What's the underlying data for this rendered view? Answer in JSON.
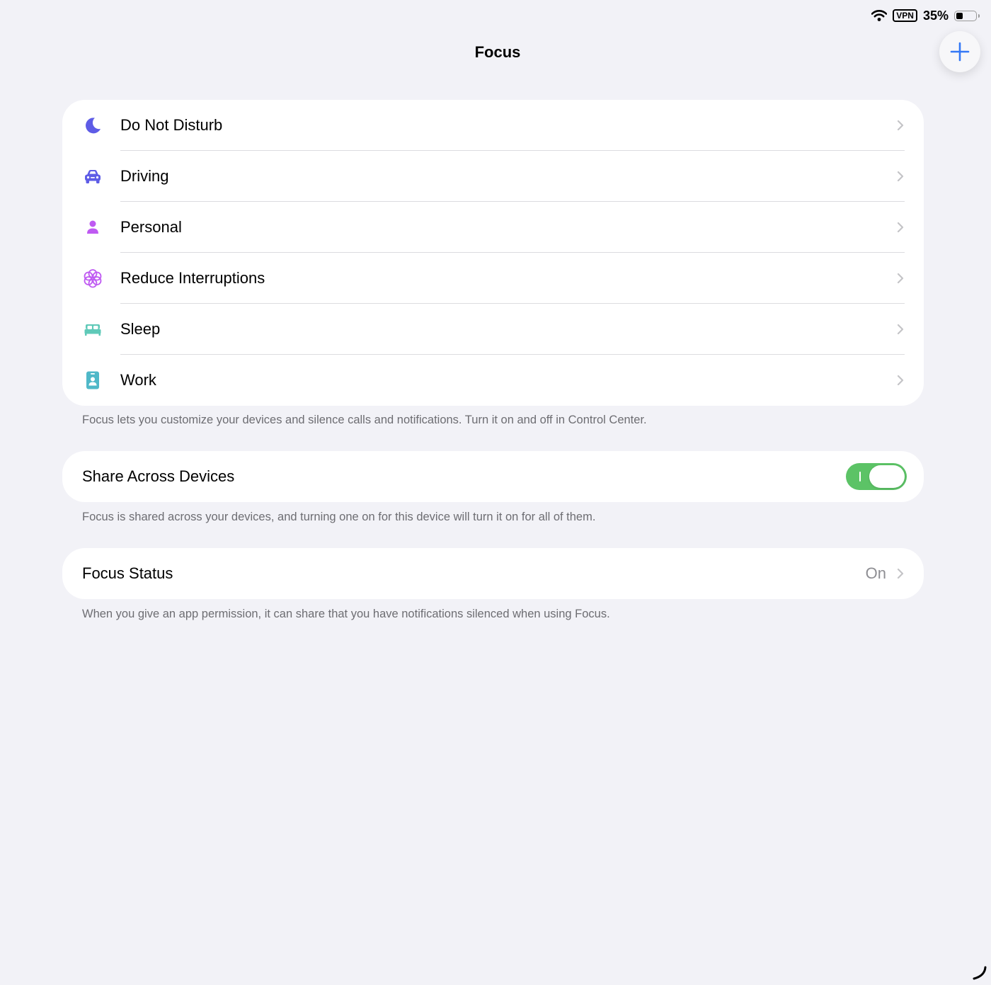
{
  "status_bar": {
    "vpn_label": "VPN",
    "battery_percent": "35%",
    "battery_level": 0.35,
    "icons": [
      "wifi-icon",
      "vpn-icon",
      "battery-icon"
    ]
  },
  "header": {
    "title": "Focus",
    "add_button_icon": "plus-icon"
  },
  "focus_modes": [
    {
      "label": "Do Not Disturb",
      "icon": "moon-icon",
      "color": "#5e5ce6"
    },
    {
      "label": "Driving",
      "icon": "car-icon",
      "color": "#5e5ce6"
    },
    {
      "label": "Personal",
      "icon": "person-icon",
      "color": "#bf5af2"
    },
    {
      "label": "Reduce Interruptions",
      "icon": "flower-icon",
      "color": "#bf5af2"
    },
    {
      "label": "Sleep",
      "icon": "bed-icon",
      "color": "#5fc9b8"
    },
    {
      "label": "Work",
      "icon": "id-badge-icon",
      "color": "#4fb8c8"
    }
  ],
  "focus_footnote": "Focus lets you customize your devices and silence calls and notifications. Turn it on and off in Control Center.",
  "share_across_devices": {
    "label": "Share Across Devices",
    "enabled": true,
    "footnote": "Focus is shared across your devices, and turning one on for this device will turn it on for all of them."
  },
  "focus_status": {
    "label": "Focus Status",
    "value": "On",
    "footnote": "When you give an app permission, it can share that you have notifications silenced when using Focus."
  },
  "colors": {
    "accent": "#3478f6",
    "toggle_on": "#5cc366",
    "background": "#f2f2f7",
    "secondary_text": "#6d6d72"
  }
}
